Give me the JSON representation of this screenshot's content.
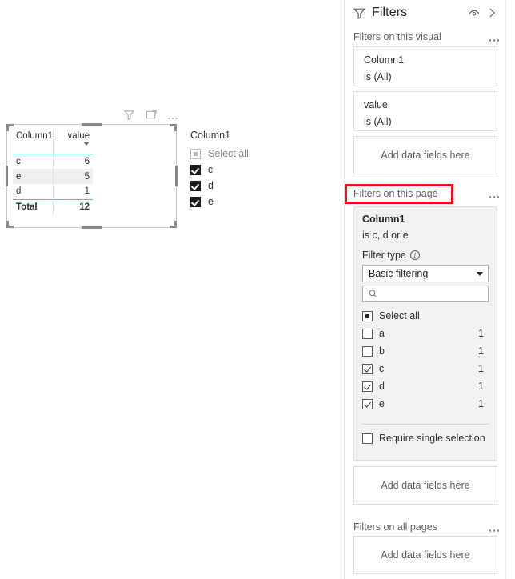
{
  "canvas": {
    "visual_toolbar": {
      "filter_icon": "filter-icon",
      "focus_icon": "focus-mode-icon",
      "more_icon": "more-options-icon"
    },
    "table_visual": {
      "columns": [
        "Column1",
        "value"
      ],
      "rows": [
        {
          "label": "c",
          "value": "6"
        },
        {
          "label": "e",
          "value": "5"
        },
        {
          "label": "d",
          "value": "1"
        }
      ],
      "total_label": "Total",
      "total_value": "12",
      "sort_indicator": "sort-descending-caret"
    },
    "slicer": {
      "title": "Column1",
      "select_all_label": "Select all",
      "items": [
        {
          "label": "c",
          "checked": true
        },
        {
          "label": "d",
          "checked": true
        },
        {
          "label": "e",
          "checked": true
        }
      ]
    }
  },
  "filter_pane": {
    "header": {
      "title": "Filters",
      "funnel_icon": "filter-funnel-icon",
      "hide_icon": "hide-pane-eye-icon",
      "collapse_icon": "chevron-right-icon"
    },
    "visual_section": {
      "heading": "Filters on this visual",
      "more_icon": "more-options-icon",
      "cards": [
        {
          "field": "Column1",
          "condition": "is (All)"
        },
        {
          "field": "value",
          "condition": "is (All)"
        }
      ],
      "dropzone": "Add data fields here"
    },
    "page_section": {
      "heading": "Filters on this page",
      "more_icon": "more-options-icon",
      "highlighted": true,
      "highlight_color": "#e81123",
      "card": {
        "field": "Column1",
        "condition": "is c, d or e",
        "filter_type_label": "Filter type",
        "filter_type_info_icon": "info-icon",
        "filter_type_value": "Basic filtering",
        "search_placeholder": "",
        "search_value": "",
        "search_icon": "search-magnifier-icon",
        "select_all_label": "Select all",
        "select_all_state": "indeterminate",
        "values": [
          {
            "label": "a",
            "count": "1",
            "checked": false
          },
          {
            "label": "b",
            "count": "1",
            "checked": false
          },
          {
            "label": "c",
            "count": "1",
            "checked": true
          },
          {
            "label": "d",
            "count": "1",
            "checked": true
          },
          {
            "label": "e",
            "count": "1",
            "checked": true
          }
        ],
        "require_single_selection_label": "Require single selection",
        "require_single_selection_checked": false
      },
      "dropzone": "Add data fields here"
    },
    "all_pages_section": {
      "heading": "Filters on all pages",
      "more_icon": "more-options-icon",
      "dropzone": "Add data fields here"
    }
  }
}
